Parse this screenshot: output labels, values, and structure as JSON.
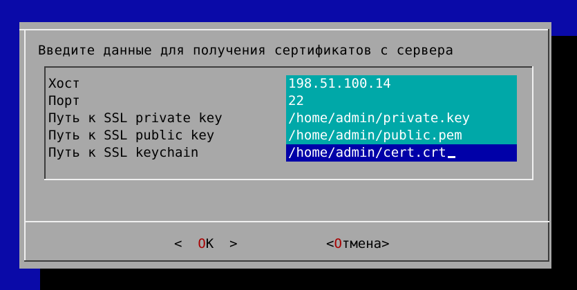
{
  "dialog": {
    "prompt": "Введите данные для получения сертификатов с сервера",
    "fields": [
      {
        "label": "Хост",
        "value": "198.51.100.14"
      },
      {
        "label": "Порт",
        "value": "22"
      },
      {
        "label": "Путь к SSL private key",
        "value": "/home/admin/private.key"
      },
      {
        "label": "Путь к SSL public key",
        "value": "/home/admin/public.pem"
      },
      {
        "label": "Путь к SSL keychain",
        "value": "/home/admin/cert.crt"
      }
    ],
    "buttons": {
      "ok": {
        "left": "<  ",
        "hot": "O",
        "rest": "K",
        "right": "  >"
      },
      "cancel": {
        "left": "<",
        "hot": "О",
        "rest": "тмена",
        "right": ">"
      }
    }
  },
  "colors": {
    "background": "#0a0aa8",
    "dialog": "#a8a8a8",
    "field": "#00a8a8",
    "field_active": "#0000a8",
    "hotkey": "#a80000"
  }
}
